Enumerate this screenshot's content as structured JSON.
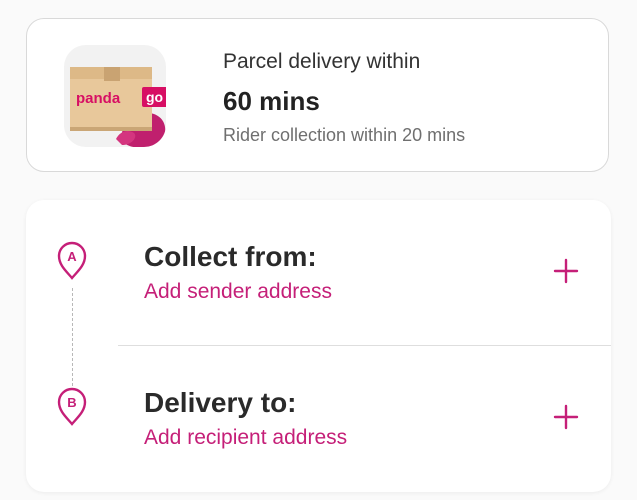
{
  "colors": {
    "accent": "#c51f78",
    "box": "#e8c89b",
    "box_dark": "#caa676",
    "brand_pink": "#d70f64"
  },
  "product": {
    "logo_text_left": "panda",
    "logo_text_right": "go",
    "icon": "parcel-box-icon"
  },
  "info": {
    "line1": "Parcel delivery within",
    "line2": "60 mins",
    "line3": "Rider collection within 20 mins"
  },
  "addresses": [
    {
      "marker": "A",
      "title": "Collect from:",
      "placeholder": "Add sender address",
      "action_icon": "plus-icon"
    },
    {
      "marker": "B",
      "title": "Delivery to:",
      "placeholder": "Add recipient address",
      "action_icon": "plus-icon"
    }
  ]
}
